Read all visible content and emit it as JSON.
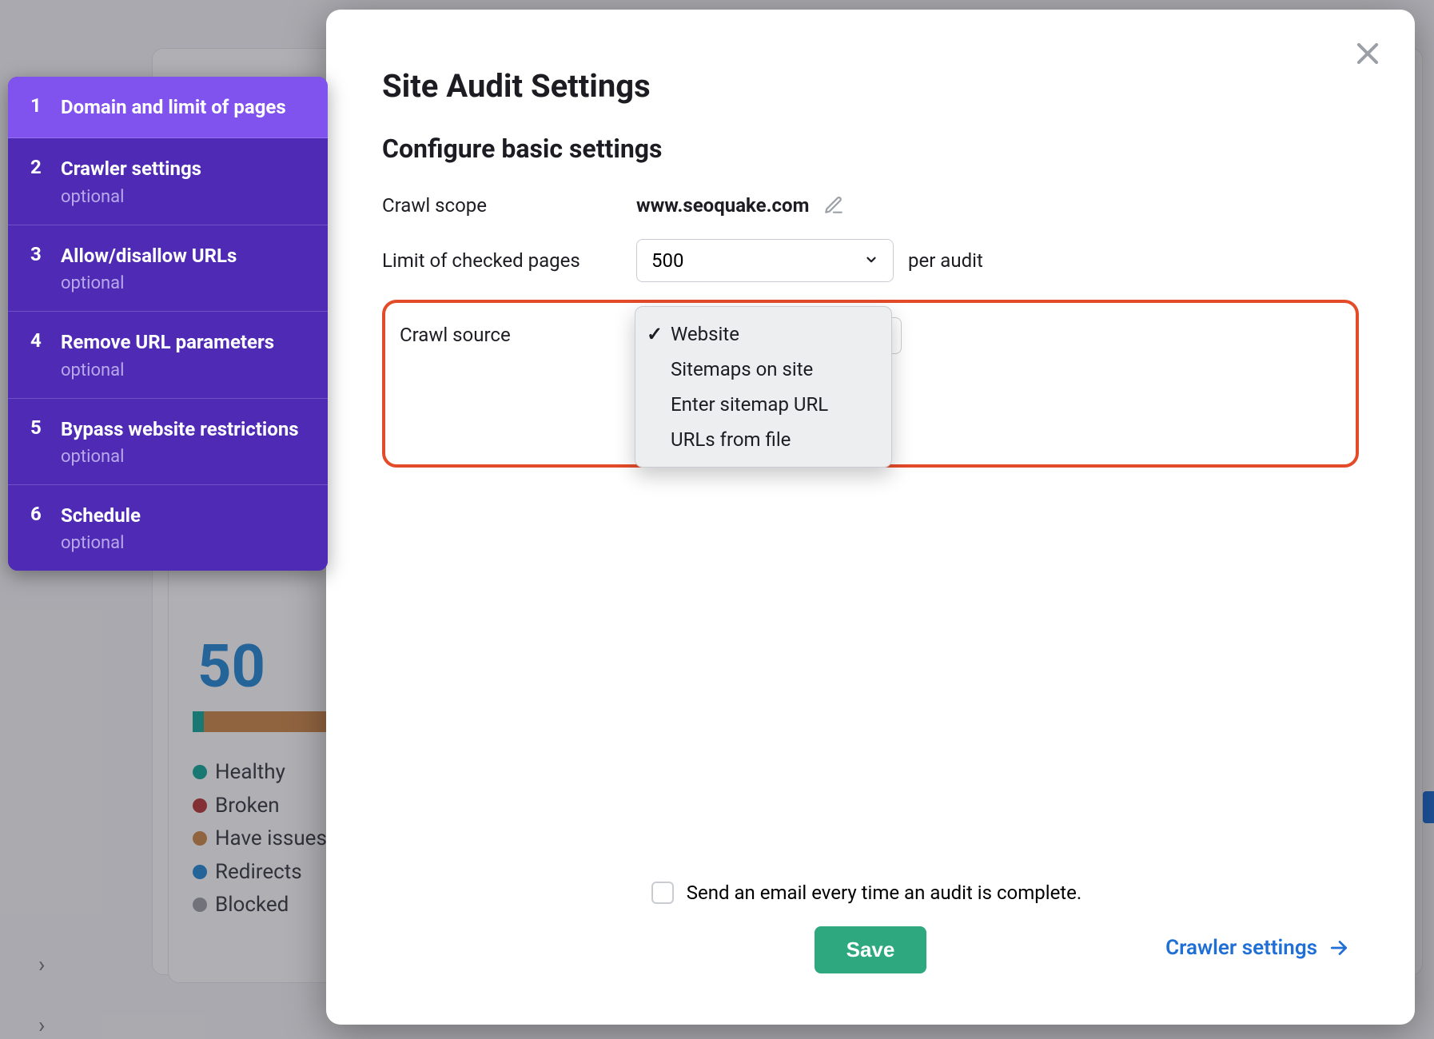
{
  "background": {
    "big_number": "50",
    "legend": {
      "healthy": "Healthy",
      "broken": "Broken",
      "issues": "Have issues",
      "redirects": "Redirects",
      "blocked": "Blocked"
    }
  },
  "wizard": {
    "items": [
      {
        "num": "1",
        "title": "Domain and limit of pages",
        "optional": ""
      },
      {
        "num": "2",
        "title": "Crawler settings",
        "optional": "optional"
      },
      {
        "num": "3",
        "title": "Allow/disallow URLs",
        "optional": "optional"
      },
      {
        "num": "4",
        "title": "Remove URL parameters",
        "optional": "optional"
      },
      {
        "num": "5",
        "title": "Bypass website restrictions",
        "optional": "optional"
      },
      {
        "num": "6",
        "title": "Schedule",
        "optional": "optional"
      }
    ]
  },
  "modal": {
    "title": "Site Audit Settings",
    "subtitle": "Configure basic settings",
    "crawl_scope_label": "Crawl scope",
    "crawl_scope_value": "www.seoquake.com",
    "limit_label": "Limit of checked pages",
    "limit_value": "500",
    "per_audit": "per audit",
    "crawl_source_label": "Crawl source",
    "crawl_source_options": [
      {
        "label": "Website",
        "selected": true
      },
      {
        "label": "Sitemaps on site",
        "selected": false
      },
      {
        "label": "Enter sitemap URL",
        "selected": false
      },
      {
        "label": "URLs from file",
        "selected": false
      }
    ],
    "email_checkbox_label": "Send an email every time an audit is complete.",
    "save_label": "Save",
    "next_label": "Crawler settings"
  }
}
